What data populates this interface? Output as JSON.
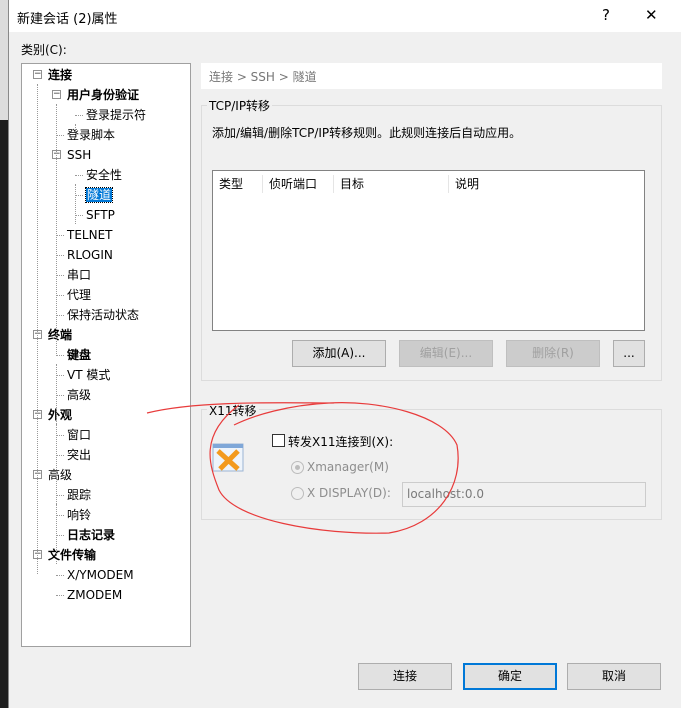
{
  "window": {
    "title": "新建会话 (2)属性",
    "help": "?",
    "close": "✕"
  },
  "category_label": "类别(C):",
  "tree": [
    {
      "label": "连接",
      "level": 0,
      "bold": true,
      "expander": "−"
    },
    {
      "label": "用户身份验证",
      "level": 1,
      "bold": true,
      "expander": "−"
    },
    {
      "label": "登录提示符",
      "level": 2
    },
    {
      "label": "登录脚本",
      "level": 1
    },
    {
      "label": "SSH",
      "level": 1,
      "expander": "−"
    },
    {
      "label": "安全性",
      "level": 2
    },
    {
      "label": "隧道",
      "level": 2,
      "selected": true
    },
    {
      "label": "SFTP",
      "level": 2
    },
    {
      "label": "TELNET",
      "level": 1
    },
    {
      "label": "RLOGIN",
      "level": 1
    },
    {
      "label": "串口",
      "level": 1
    },
    {
      "label": "代理",
      "level": 1
    },
    {
      "label": "保持活动状态",
      "level": 1
    },
    {
      "label": "终端",
      "level": 0,
      "bold": true,
      "expander": "−"
    },
    {
      "label": "键盘",
      "level": 1,
      "bold": true
    },
    {
      "label": "VT 模式",
      "level": 1
    },
    {
      "label": "高级",
      "level": 1
    },
    {
      "label": "外观",
      "level": 0,
      "bold": true,
      "expander": "−"
    },
    {
      "label": "窗口",
      "level": 1
    },
    {
      "label": "突出",
      "level": 1
    },
    {
      "label": "高级",
      "level": 0,
      "expander": "−"
    },
    {
      "label": "跟踪",
      "level": 1
    },
    {
      "label": "响铃",
      "level": 1
    },
    {
      "label": "日志记录",
      "level": 1,
      "bold": true
    },
    {
      "label": "文件传输",
      "level": 0,
      "bold": true,
      "expander": "−"
    },
    {
      "label": "X/YMODEM",
      "level": 1
    },
    {
      "label": "ZMODEM",
      "level": 1
    }
  ],
  "breadcrumb": "连接 > SSH > 隧道",
  "tcpip": {
    "title": "TCP/IP转移",
    "description": "添加/编辑/删除TCP/IP转移规则。此规则连接后自动应用。",
    "columns": [
      "类型",
      "侦听端口",
      "目标",
      "说明"
    ],
    "buttons": {
      "add": "添加(A)...",
      "edit": "编辑(E)...",
      "delete": "删除(R)",
      "more": "..."
    }
  },
  "x11": {
    "title": "X11转移",
    "forward_label": "转发X11连接到(X):",
    "forward_checked": false,
    "xmanager_label": "Xmanager(M)",
    "xdisplay_label": "X DISPLAY(D):",
    "selected": "Xmanager",
    "display_value": "localhost:0.0"
  },
  "footer": {
    "connect": "连接",
    "ok": "确定",
    "cancel": "取消"
  },
  "colors": {
    "selection": "#0078d7",
    "annotation": "#e83b3b"
  }
}
